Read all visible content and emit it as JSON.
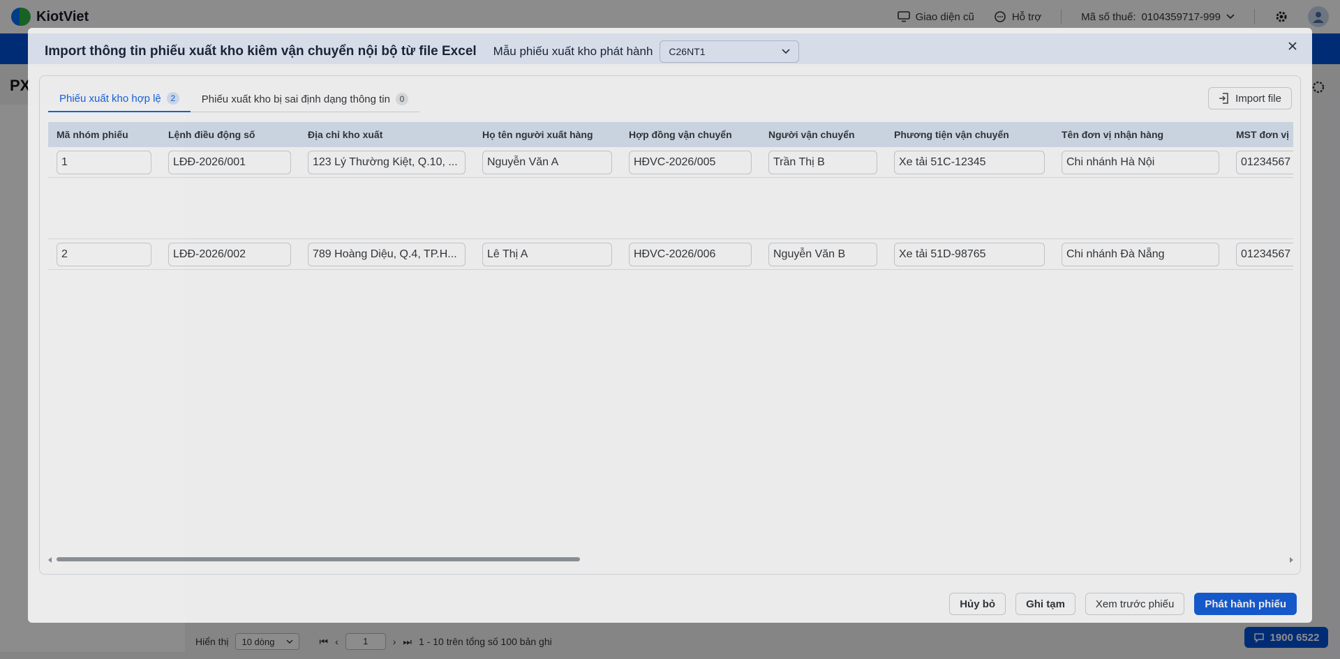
{
  "app": {
    "logo_text": "KiotViet",
    "old_ui_label": "Giao diện cũ",
    "support_label": "Hỗ trợ",
    "tax_label": "Mã số thuế:",
    "tax_code": "0104359717-999",
    "page_code": "PX",
    "hotline": "1900 6522"
  },
  "pager": {
    "show_label": "Hiển thị",
    "rows_select": "10 dòng",
    "current_page": "1",
    "summary": "1 - 10 trên tổng số 100 bản ghi"
  },
  "modal": {
    "title": "Import thông tin phiếu xuất kho kiêm vận chuyển nội bộ từ file Excel",
    "template_label": "Mẫu phiếu xuất kho phát hành",
    "template_value": "C26NT1",
    "tabs": [
      {
        "label": "Phiếu xuất kho hợp lệ",
        "count": "2"
      },
      {
        "label": "Phiếu xuất kho bị sai định dạng thông tin",
        "count": "0"
      }
    ],
    "import_button": "Import file",
    "columns": [
      "Mã nhóm phiếu",
      "Lệnh điều động số",
      "Địa chỉ kho xuất",
      "Họ tên người xuất hàng",
      "Hợp đồng vận chuyển",
      "Người vận chuyển",
      "Phương tiện vận chuyển",
      "Tên đơn vị nhận hàng",
      "MST đơn vị"
    ],
    "rows": [
      [
        "1",
        "LĐĐ-2026/001",
        "123 Lý Thường Kiệt, Q.10, ...",
        "Nguyễn Văn A",
        "HĐVC-2026/005",
        "Trần Thị B",
        "Xe tải 51C-12345",
        "Chi nhánh Hà Nội",
        "01234567"
      ],
      [
        "2",
        "LĐĐ-2026/002",
        "789 Hoàng Diệu, Q.4, TP.H...",
        "Lê Thị A",
        "HĐVC-2026/006",
        "Nguyễn Văn B",
        "Xe tải 51D-98765",
        "Chi nhánh Đà Nẵng",
        "01234567"
      ]
    ],
    "buttons": {
      "cancel": "Hủy bỏ",
      "draft": "Ghi tạm",
      "preview": "Xem trước phiếu",
      "publish": "Phát hành phiếu"
    }
  },
  "colors": {
    "brand_blue": "#0050d8",
    "tab_active": "#0058e6",
    "table_header": "#d7e2f1"
  }
}
